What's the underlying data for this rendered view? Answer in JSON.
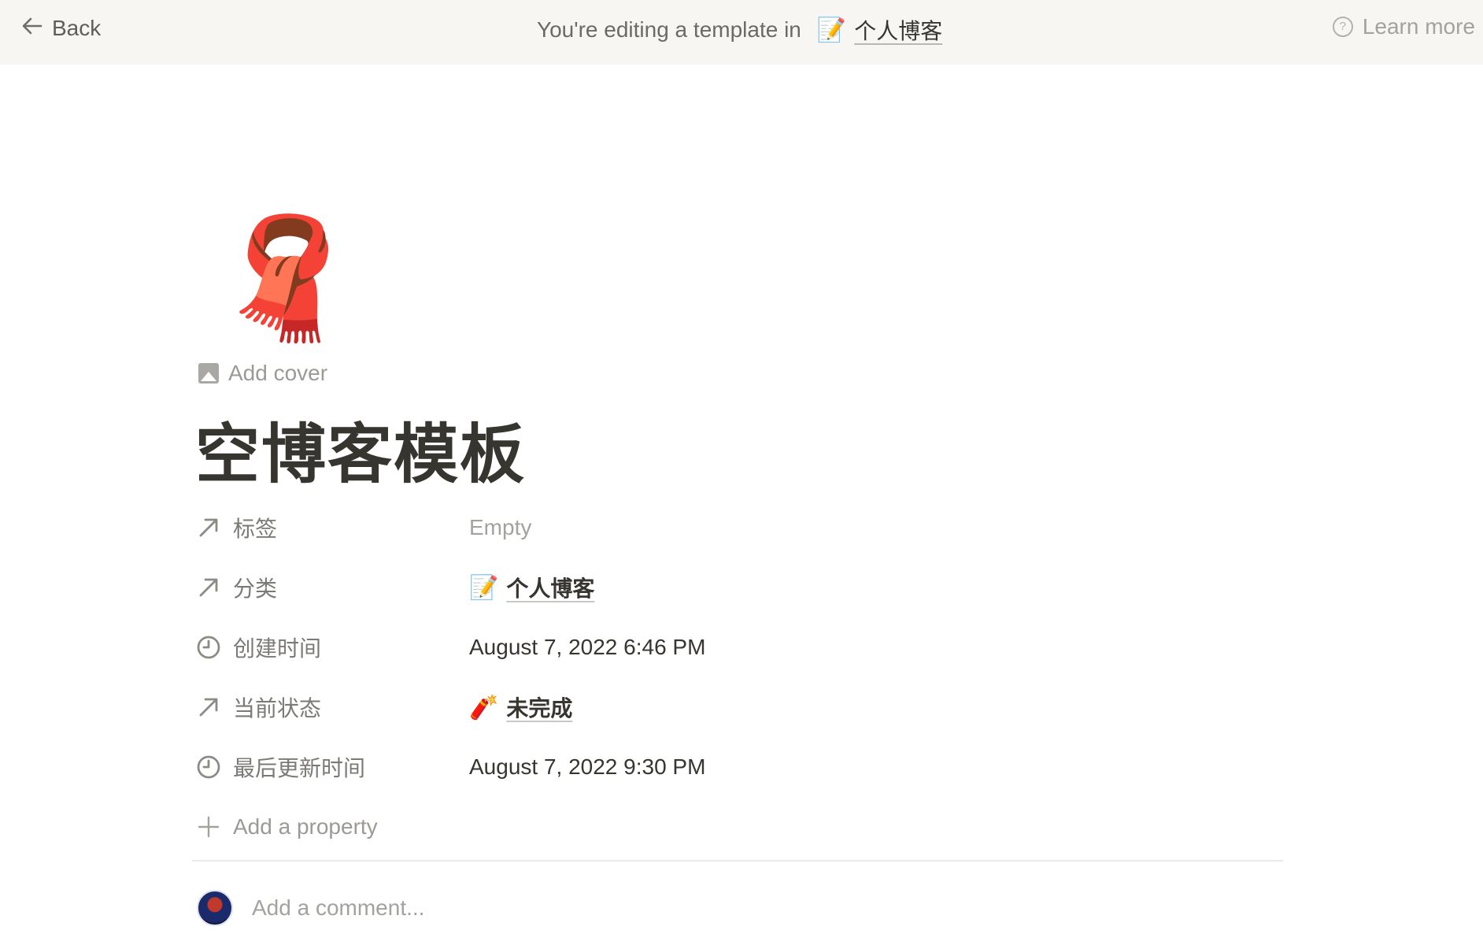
{
  "banner": {
    "back_label": "Back",
    "editing_text": "You're editing a template in",
    "database_emoji": "📝",
    "database_name": "个人博客",
    "learn_more": "Learn more",
    "help_glyph": "?"
  },
  "page": {
    "icon": "🧣",
    "add_cover": "Add cover",
    "title": "空博客模板"
  },
  "properties": [
    {
      "name": "标签",
      "icon": "relation-arrow-icon",
      "value": "Empty",
      "empty": true
    },
    {
      "name": "分类",
      "icon": "relation-arrow-icon",
      "value_emoji": "📝",
      "value": "个人博客"
    },
    {
      "name": "创建时间",
      "icon": "clock-icon",
      "value": "August 7, 2022 6:46 PM"
    },
    {
      "name": "当前状态",
      "icon": "relation-arrow-icon",
      "value_emoji": "🧨",
      "value": "未完成"
    },
    {
      "name": "最后更新时间",
      "icon": "clock-icon",
      "value": "August 7, 2022 9:30 PM"
    }
  ],
  "add_property": "Add a property",
  "comment": {
    "placeholder": "Add a comment..."
  }
}
